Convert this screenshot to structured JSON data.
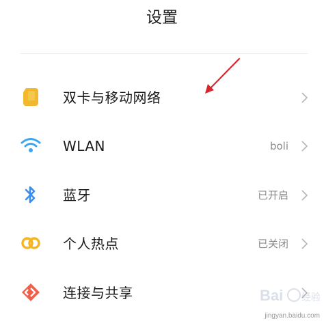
{
  "header": {
    "title": "设置"
  },
  "rows": [
    {
      "label": "双卡与移动网络",
      "value": "",
      "icon": "sim-card-icon"
    },
    {
      "label": "WLAN",
      "value": "boli",
      "icon": "wifi-icon"
    },
    {
      "label": "蓝牙",
      "value": "已开启",
      "icon": "bluetooth-icon"
    },
    {
      "label": "个人热点",
      "value": "已关闭",
      "icon": "hotspot-icon"
    },
    {
      "label": "连接与共享",
      "value": "",
      "icon": "connection-sharing-icon"
    }
  ],
  "watermark": {
    "brand": "Baidu经验",
    "url": "jingyan.baidu.com"
  },
  "colors": {
    "sim": "#f2b92e",
    "wifi": "#3aa6f0",
    "bluetooth": "#3a8ef0",
    "hotspot": "#f5b520",
    "share": "#f2604a",
    "annotation": "#d8262c"
  }
}
